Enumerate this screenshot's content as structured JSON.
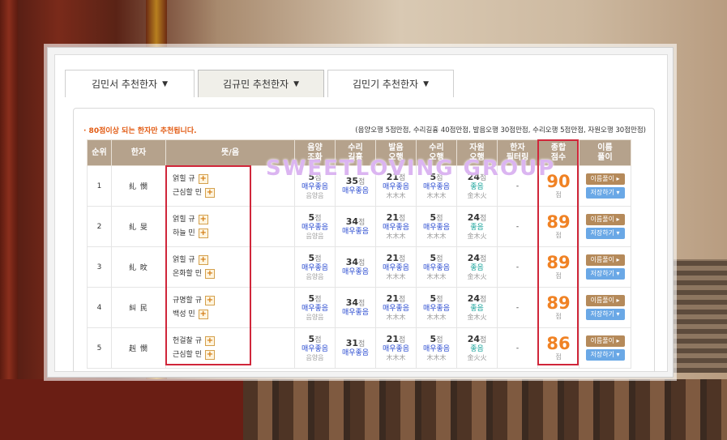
{
  "tabs": [
    {
      "label": "김민서 추천한자"
    },
    {
      "label": "김규민 추천한자"
    },
    {
      "label": "김민기 추천한자"
    }
  ],
  "note_left": "· 80점이상 되는 한자만 추천됩니다.",
  "note_right": "(음양오행 5점만점, 수리길흉 40점만점, 발음오행 30점만점, 수리오행 5점만점, 자원오행 30점만점)",
  "headers": {
    "rank": "순위",
    "hanja": "한자",
    "meaning": "뜻/음",
    "eumyang": [
      "음양",
      "조화"
    ],
    "suri": [
      "수리",
      "길흉"
    ],
    "pronun": [
      "발음",
      "오행"
    ],
    "suri_ohaeng": [
      "수리",
      "오행"
    ],
    "jawon": [
      "자원",
      "오행"
    ],
    "filter": [
      "한자",
      "필터링"
    ],
    "total": [
      "종합",
      "점수"
    ],
    "share": [
      "이름",
      "풀이"
    ]
  },
  "rows": [
    {
      "rank": "1",
      "hanja": "糺 憫",
      "m1": "얽힐 규",
      "m2": "근심할 민",
      "eu_pts": "5",
      "eu_grade": "매우좋음",
      "eu_sub": "음양음",
      "su_pts": "35",
      "su_grade": "매우좋음",
      "pr_pts": "21",
      "pr_grade": "매우좋음",
      "pr_sub": "木木木",
      "so_pts": "5",
      "so_grade": "매우좋음",
      "so_sub": "木木木",
      "ja_pts": "24",
      "ja_grade": "좋음",
      "ja_sub": "金木火",
      "filter": "-",
      "total": "90"
    },
    {
      "rank": "2",
      "hanja": "糺 旻",
      "m1": "얽힐 규",
      "m2": "하늘 민",
      "eu_pts": "5",
      "eu_grade": "매우좋음",
      "eu_sub": "음양음",
      "su_pts": "34",
      "su_grade": "매우좋음",
      "pr_pts": "21",
      "pr_grade": "매우좋음",
      "pr_sub": "木木木",
      "so_pts": "5",
      "so_grade": "매우좋음",
      "so_sub": "木木木",
      "ja_pts": "24",
      "ja_grade": "좋음",
      "ja_sub": "金木火",
      "filter": "-",
      "total": "89"
    },
    {
      "rank": "3",
      "hanja": "糺 旼",
      "m1": "얽힐 규",
      "m2": "온화할 민",
      "eu_pts": "5",
      "eu_grade": "매우좋음",
      "eu_sub": "음양음",
      "su_pts": "34",
      "su_grade": "매우좋음",
      "pr_pts": "21",
      "pr_grade": "매우좋음",
      "pr_sub": "木木木",
      "so_pts": "5",
      "so_grade": "매우좋음",
      "so_sub": "木木木",
      "ja_pts": "24",
      "ja_grade": "좋음",
      "ja_sub": "金木火",
      "filter": "-",
      "total": "89"
    },
    {
      "rank": "4",
      "hanja": "糾 民",
      "m1": "규명할 규",
      "m2": "백성 민",
      "eu_pts": "5",
      "eu_grade": "매우좋음",
      "eu_sub": "음양음",
      "su_pts": "34",
      "su_grade": "매우좋음",
      "pr_pts": "21",
      "pr_grade": "매우좋음",
      "pr_sub": "木木木",
      "so_pts": "5",
      "so_grade": "매우좋음",
      "so_sub": "木木木",
      "ja_pts": "24",
      "ja_grade": "좋음",
      "ja_sub": "金木火",
      "filter": "-",
      "total": "89"
    },
    {
      "rank": "5",
      "hanja": "赳 憫",
      "m1": "헌걸찰 규",
      "m2": "근심할 민",
      "eu_pts": "5",
      "eu_grade": "매우좋음",
      "eu_sub": "음양음",
      "su_pts": "31",
      "su_grade": "매우좋음",
      "pr_pts": "21",
      "pr_grade": "매우좋음",
      "pr_sub": "木木木",
      "so_pts": "5",
      "so_grade": "매우좋음",
      "so_sub": "木木木",
      "ja_pts": "24",
      "ja_grade": "좋음",
      "ja_sub": "金火火",
      "filter": "-",
      "total": "86"
    }
  ],
  "pts_unit": "점",
  "btn_share": "이름풀이 ▸",
  "btn_save": "저장하기 ▾",
  "watermark": "SWEETLOVING GROUP",
  "colors": {
    "header_bg": "#b5a28c",
    "accent_orange": "#f08224",
    "highlight_red": "#d0263a"
  }
}
